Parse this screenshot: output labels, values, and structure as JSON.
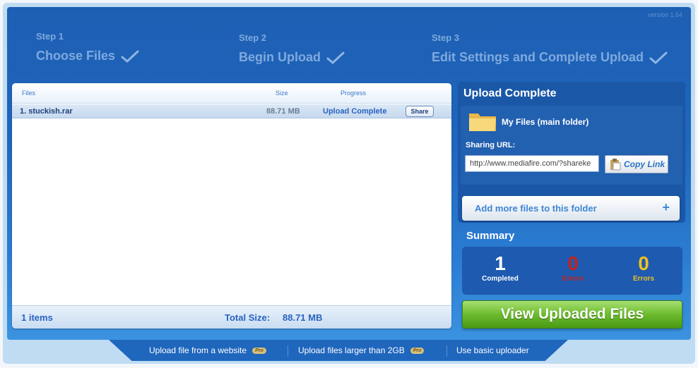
{
  "version": "version 1.64",
  "steps": [
    {
      "num": "Step 1",
      "title": "Choose Files"
    },
    {
      "num": "Step 2",
      "title": "Begin Upload"
    },
    {
      "num": "Step 3",
      "title": "Edit Settings and Complete Upload"
    }
  ],
  "table": {
    "headers": {
      "files": "Files",
      "size": "Size",
      "progress": "Progress"
    },
    "rows": [
      {
        "name": "1. stuckish.rar",
        "size": "88.71 MB",
        "progress": "Upload Complete",
        "share": "Share"
      }
    ],
    "footer": {
      "items": "1 items",
      "total_label": "Total Size:",
      "total_value": "88.71 MB"
    }
  },
  "upload_complete": {
    "title": "Upload Complete",
    "folder_name": "My Files (main folder)",
    "sharing_label": "Sharing URL:",
    "sharing_url": "http://www.mediafire.com/?shareke",
    "copy_link": "Copy Link",
    "add_more": "Add more files to this folder",
    "plus": "+"
  },
  "summary": {
    "title": "Summary",
    "items": [
      {
        "value": "1",
        "label": "Completed",
        "color": "#ffffff"
      },
      {
        "value": "0",
        "label": "Errors",
        "color": "#c8221b"
      },
      {
        "value": "0",
        "label": "Errors",
        "color": "#f0c020"
      }
    ]
  },
  "view_button": "View Uploaded Files",
  "bottom_links": [
    {
      "label": "Upload file from a website",
      "pro": "Pro"
    },
    {
      "label": "Upload files larger than 2GB",
      "pro": "Pro"
    },
    {
      "label": "Use basic uploader"
    }
  ]
}
